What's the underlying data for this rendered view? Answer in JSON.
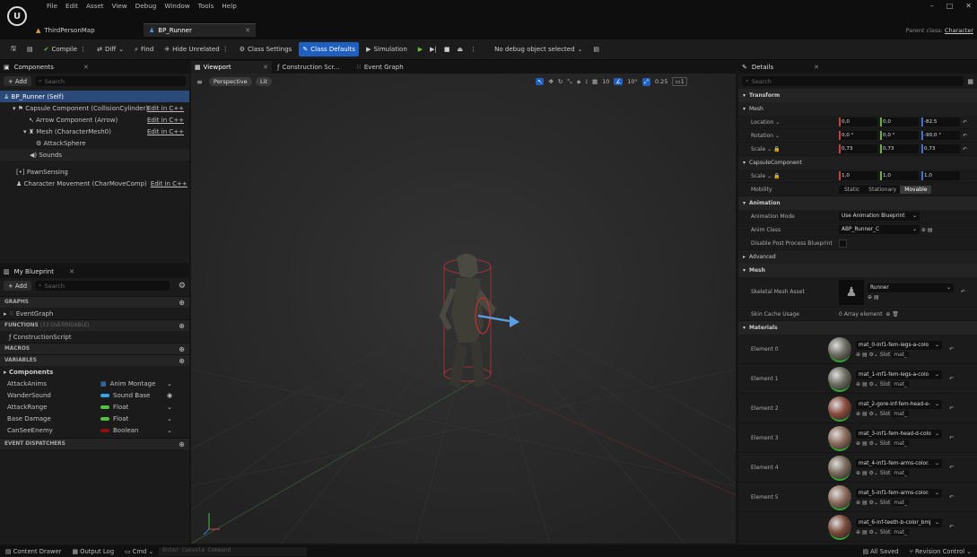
{
  "menu": [
    "File",
    "Edit",
    "Asset",
    "View",
    "Debug",
    "Window",
    "Tools",
    "Help"
  ],
  "tabs": {
    "map": "ThirdPersonMap",
    "asset": "BP_Runner"
  },
  "window": {
    "parent_class_label": "Parent class:",
    "parent_class": "Character",
    "min": "–",
    "max": "□",
    "close": "✕"
  },
  "toolbar": {
    "compile": "Compile",
    "diff": "Diff",
    "find": "Find",
    "hide_unrelated": "Hide Unrelated",
    "class_settings": "Class Settings",
    "class_defaults": "Class Defaults",
    "simulation": "Simulation",
    "debug_object": "No debug object selected"
  },
  "components": {
    "title": "Components",
    "add": "+ Add",
    "search": "Search",
    "items": [
      {
        "label": "BP_Runner (Self)",
        "edit": ""
      },
      {
        "label": "Capsule Component (CollisionCylinder)",
        "edit": "Edit in C++"
      },
      {
        "label": "Arrow Component (Arrow)",
        "edit": "Edit in C++"
      },
      {
        "label": "Mesh (CharacterMesh0)",
        "edit": "Edit in C++"
      },
      {
        "label": "AttackSphere",
        "edit": ""
      },
      {
        "label": "Sounds",
        "edit": ""
      },
      {
        "label": "PawnSensing",
        "edit": ""
      },
      {
        "label": "Character Movement (CharMoveComp)",
        "edit": "Edit in C++"
      }
    ]
  },
  "myblueprint": {
    "title": "My Blueprint",
    "add": "+ Add",
    "search": "Search",
    "graphs": "GRAPHS",
    "eventgraph": "EventGraph",
    "functions": "FUNCTIONS",
    "functions_count": "(33 OVERRIDABLE)",
    "construction": "ConstructionScript",
    "macros": "MACROS",
    "variables": "VARIABLES",
    "components": "Components",
    "vars": [
      {
        "name": "AttackAnims",
        "type": "Anim Montage",
        "color": "#3a8fe0"
      },
      {
        "name": "WanderSound",
        "type": "Sound Base",
        "color": "#2ea8e8"
      },
      {
        "name": "AttackRange",
        "type": "Float",
        "color": "#55c040"
      },
      {
        "name": "Base Damage",
        "type": "Float",
        "color": "#55c040"
      },
      {
        "name": "CanSeeEnemy",
        "type": "Boolean",
        "color": "#8c1010"
      }
    ],
    "dispatchers": "EVENT DISPATCHERS"
  },
  "viewport": {
    "tabs": [
      "Viewport",
      "Construction Scr...",
      "Event Graph"
    ],
    "perspective": "Perspective",
    "lit": "Lit",
    "grid": "10",
    "angle": "10°",
    "scale": "0.25",
    "cam": "1"
  },
  "details": {
    "title": "Details",
    "search": "Search",
    "transform": "Transform",
    "mesh_sub": "Mesh",
    "location": {
      "label": "Location",
      "x": "0,0",
      "y": "0,0",
      "z": "-82,5"
    },
    "rotation": {
      "label": "Rotation",
      "x": "0,0 °",
      "y": "0,0 °",
      "z": "-90,0 °"
    },
    "scale": {
      "label": "Scale",
      "x": "0,73",
      "y": "0,73",
      "z": "0,73"
    },
    "capsule": "CapsuleComponent",
    "cscale": {
      "label": "Scale",
      "x": "1,0",
      "y": "1,0",
      "z": "1,0"
    },
    "mobility": {
      "label": "Mobility",
      "static": "Static",
      "stationary": "Stationary",
      "movable": "Movable"
    },
    "animation": "Animation",
    "anim_mode": {
      "label": "Animation Mode",
      "value": "Use Animation Blueprint"
    },
    "anim_class": {
      "label": "Anim Class",
      "value": "ABP_Runner_C"
    },
    "disable_pp": "Disable Post Process Blueprint",
    "advanced": "Advanced",
    "mesh": "Mesh",
    "skeletal": {
      "label": "Skeletal Mesh Asset",
      "value": "Runner"
    },
    "skin": {
      "label": "Skin Cache Usage",
      "value": "0 Array element"
    },
    "materials": "Materials",
    "slot": "Slot",
    "slot_val": "mat_",
    "elements": [
      {
        "label": "Element 0",
        "mat": "mat_0-inf1-fem-legs-a-colo",
        "color": "#6b6b60"
      },
      {
        "label": "Element 1",
        "mat": "mat_1-inf1-fem-legs-a-colo",
        "color": "#6b6b60"
      },
      {
        "label": "Element 2",
        "mat": "mat_2-gore-inf-fem-head-e-",
        "color": "#8a4a3c"
      },
      {
        "label": "Element 3",
        "mat": "mat_3-inf1-fem-head-d-colo",
        "color": "#8a6a5a"
      },
      {
        "label": "Element 4",
        "mat": "mat_4-inf1-fem-arms-color.",
        "color": "#7a6a5a"
      },
      {
        "label": "Element 5",
        "mat": "mat_5-inf1-fem-arms-color.",
        "color": "#8a6a5a"
      },
      {
        "label": "",
        "mat": "mat_6-inf-teeth-b-color_bmj",
        "color": "#7a4a3a"
      }
    ]
  },
  "status": {
    "content_drawer": "Content Drawer",
    "output_log": "Output Log",
    "cmd": "Cmd",
    "console": "Enter Console Command",
    "all_saved": "All Saved",
    "revision": "Revision Control"
  }
}
